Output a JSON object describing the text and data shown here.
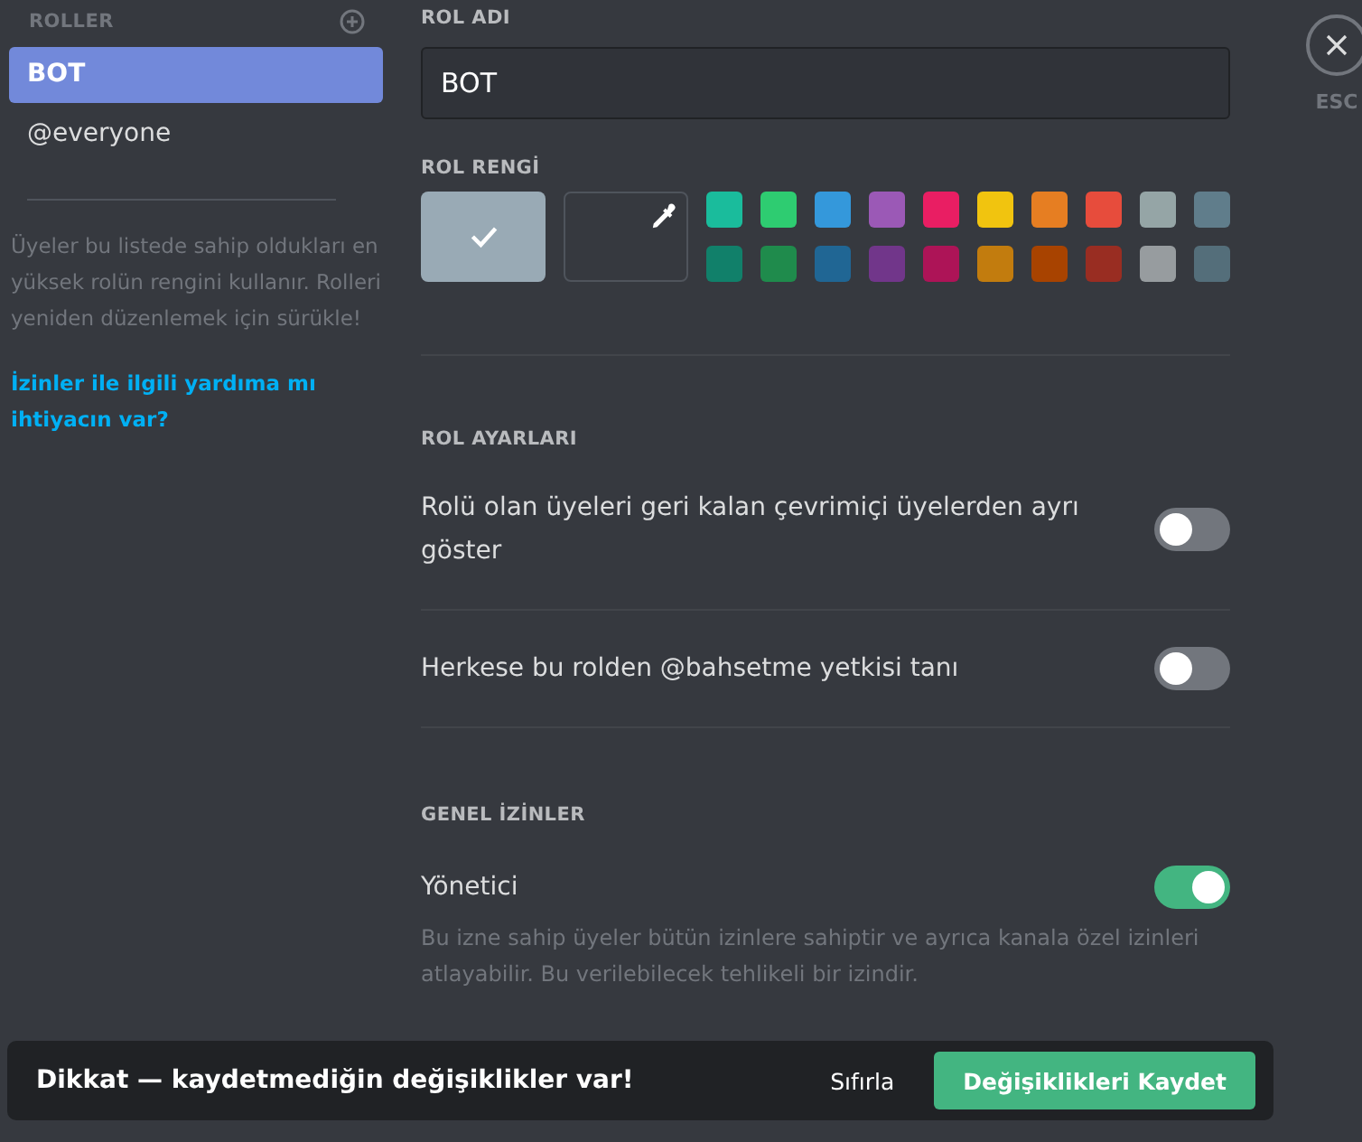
{
  "sidebar": {
    "title": "ROLLER",
    "roles": [
      {
        "label": "BOT",
        "selected": true
      },
      {
        "label": "@everyone",
        "selected": false
      }
    ],
    "help_text": "Üyeler bu listede sahip oldukları en yüksek rolün rengini kullanır. Rolleri yeniden düzenlemek için sürükle!",
    "help_link": "İzinler ile ilgili yardıma mı ihtiyacın var?"
  },
  "role_name": {
    "label": "ROL ADI",
    "value": "BOT"
  },
  "role_color": {
    "label": "ROL RENGİ",
    "default": {
      "color": "#99aab5",
      "selected": true
    },
    "swatches": [
      {
        "color": "#1abc9c",
        "selected": false
      },
      {
        "color": "#2ecc71",
        "selected": false
      },
      {
        "color": "#3498db",
        "selected": false
      },
      {
        "color": "#9b59b6",
        "selected": false
      },
      {
        "color": "#e91e63",
        "selected": false
      },
      {
        "color": "#f1c40f",
        "selected": false
      },
      {
        "color": "#e67e22",
        "selected": false
      },
      {
        "color": "#e74c3c",
        "selected": false
      },
      {
        "color": "#95a5a6",
        "selected": false
      },
      {
        "color": "#607d8b",
        "selected": false
      },
      {
        "color": "#11806a",
        "selected": false
      },
      {
        "color": "#1f8b4c",
        "selected": false
      },
      {
        "color": "#206694",
        "selected": false
      },
      {
        "color": "#71368a",
        "selected": false
      },
      {
        "color": "#ad1457",
        "selected": false
      },
      {
        "color": "#c27c0e",
        "selected": false
      },
      {
        "color": "#a84300",
        "selected": false
      },
      {
        "color": "#992d22",
        "selected": false
      },
      {
        "color": "#979c9f",
        "selected": false
      },
      {
        "color": "#546e7a",
        "selected": false
      }
    ]
  },
  "role_settings": {
    "label": "ROL AYARLARI",
    "items": [
      {
        "label": "Rolü olan üyeleri geri kalan çevrimiçi üyelerden ayrı göster",
        "on": false
      },
      {
        "label": "Herkese bu rolden @bahsetme yetkisi tanı",
        "on": false
      }
    ]
  },
  "general_permissions": {
    "label": "GENEL İZİNLER",
    "items": [
      {
        "label": "Yönetici",
        "on": true,
        "description": "Bu izne sahip üyeler bütün izinlere sahiptir ve ayrıca kanala özel izinleri atlayabilir. Bu verilebilecek tehlikeli bir izindir."
      }
    ]
  },
  "close": {
    "label": "ESC"
  },
  "notice": {
    "message": "Dikkat — kaydetmediğin değişiklikler var!",
    "reset": "Sıfırla",
    "save": "Değişiklikleri Kaydet"
  }
}
